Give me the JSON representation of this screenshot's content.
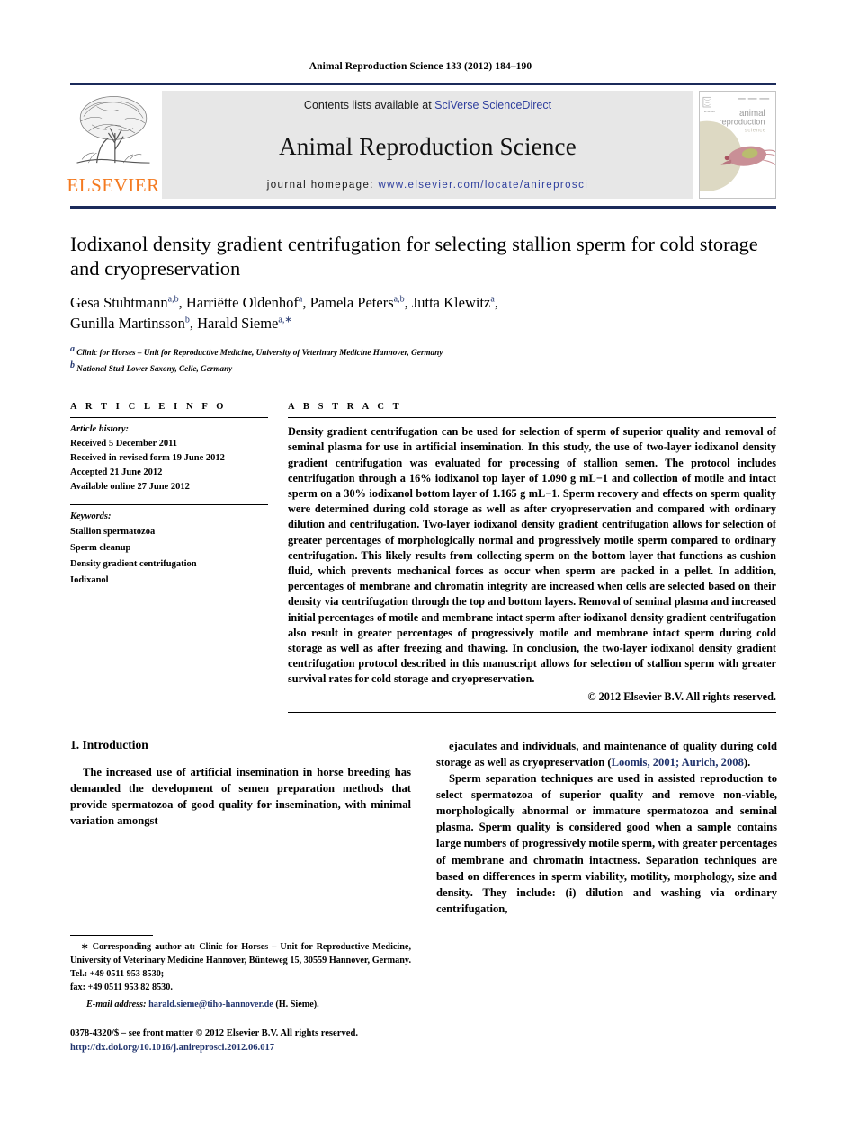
{
  "running_head": "Animal Reproduction Science 133 (2012) 184–190",
  "masthead": {
    "publisher_wordmark": "ELSEVIER",
    "contents_prefix": "Contents lists available at ",
    "contents_link": "SciVerse ScienceDirect",
    "journal_title": "Animal Reproduction Science",
    "homepage_prefix": "journal homepage: ",
    "homepage_url": "www.elsevier.com/locate/anireprosci",
    "cover_title_line1": "animal",
    "cover_title_line2": "reproduction",
    "cover_title_line3": "science",
    "rule_color": "#1b2a5a",
    "link_color": "#2f3f9e",
    "elsevier_orange": "#f47a20"
  },
  "article": {
    "title": "Iodixanol density gradient centrifugation for selecting stallion sperm for cold storage and cryopreservation",
    "authors_line1_parts": [
      {
        "name": "Gesa Stuhtmann",
        "sup": "a,b"
      },
      {
        "name": "Harriëtte Oldenhof",
        "sup": "a"
      },
      {
        "name": "Pamela Peters",
        "sup": "a,b"
      },
      {
        "name": "Jutta Klewitz",
        "sup": "a"
      }
    ],
    "authors_line2_parts": [
      {
        "name": "Gunilla Martinsson",
        "sup": "b"
      },
      {
        "name": "Harald Sieme",
        "sup": "a,∗"
      }
    ],
    "affiliations": [
      {
        "marker": "a",
        "text": "Clinic for Horses – Unit for Reproductive Medicine, University of Veterinary Medicine Hannover, Germany"
      },
      {
        "marker": "b",
        "text": "National Stud Lower Saxony, Celle, Germany"
      }
    ]
  },
  "article_info": {
    "heading": "A R T I C L E    I N F O",
    "history_label": "Article history:",
    "history": [
      "Received 5 December 2011",
      "Received in revised form 19 June 2012",
      "Accepted 21 June 2012",
      "Available online 27 June 2012"
    ],
    "keywords_label": "Keywords:",
    "keywords": [
      "Stallion spermatozoa",
      "Sperm cleanup",
      "Density gradient centrifugation",
      "Iodixanol"
    ]
  },
  "abstract": {
    "heading": "A B S T R A C T",
    "text": "Density gradient centrifugation can be used for selection of sperm of superior quality and removal of seminal plasma for use in artificial insemination. In this study, the use of two-layer iodixanol density gradient centrifugation was evaluated for processing of stallion semen. The protocol includes centrifugation through a 16% iodixanol top layer of 1.090 g mL−1 and collection of motile and intact sperm on a 30% iodixanol bottom layer of 1.165 g mL−1. Sperm recovery and effects on sperm quality were determined during cold storage as well as after cryopreservation and compared with ordinary dilution and centrifugation. Two-layer iodixanol density gradient centrifugation allows for selection of greater percentages of morphologically normal and progressively motile sperm compared to ordinary centrifugation. This likely results from collecting sperm on the bottom layer that functions as cushion fluid, which prevents mechanical forces as occur when sperm are packed in a pellet. In addition, percentages of membrane and chromatin integrity are increased when cells are selected based on their density via centrifugation through the top and bottom layers. Removal of seminal plasma and increased initial percentages of motile and membrane intact sperm after iodixanol density gradient centrifugation also result in greater percentages of progressively motile and membrane intact sperm during cold storage as well as after freezing and thawing. In conclusion, the two-layer iodixanol density gradient centrifugation protocol described in this manuscript allows for selection of stallion sperm with greater survival rates for cold storage and cryopreservation.",
    "copyright": "© 2012 Elsevier B.V. All rights reserved."
  },
  "body": {
    "section_heading": "1. Introduction",
    "left_paragraph": "The increased use of artificial insemination in horse breeding has demanded the development of semen preparation methods that provide spermatozoa of good quality for insemination, with minimal variation amongst",
    "right_paragraph_1_pre": "ejaculates and individuals, and maintenance of quality during cold storage as well as cryopreservation (",
    "right_paragraph_1_cite": "Loomis, 2001; Aurich, 2008",
    "right_paragraph_1_post": ").",
    "right_paragraph_2": "Sperm separation techniques are used in assisted reproduction to select spermatozoa of superior quality and remove non-viable, morphologically abnormal or immature spermatozoa and seminal plasma. Sperm quality is considered good when a sample contains large numbers of progressively motile sperm, with greater percentages of membrane and chromatin intactness. Separation techniques are based on differences in sperm viability, motility, morphology, size and density. They include: (i) dilution and washing via ordinary centrifugation,"
  },
  "footnotes": {
    "corresponding_marker": "∗",
    "corresponding_text": "Corresponding author at: Clinic for Horses – Unit for Reproductive Medicine, University of Veterinary Medicine Hannover, Bünteweg 15, 30559 Hannover, Germany. Tel.: +49 0511 953 8530;",
    "fax_line": "fax: +49 0511 953 82 8530.",
    "email_label": "E-mail address:",
    "email": "harald.sieme@tiho-hannover.de",
    "email_suffix": "(H. Sieme)."
  },
  "imprint": {
    "issn_line": "0378-4320/$ – see front matter © 2012 Elsevier B.V. All rights reserved.",
    "doi": "http://dx.doi.org/10.1016/j.anireprosci.2012.06.017"
  }
}
